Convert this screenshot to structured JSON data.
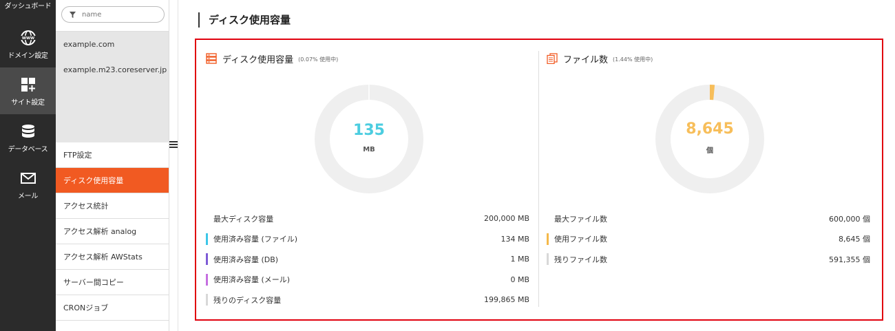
{
  "rail": {
    "top_label": "ダッシュボード",
    "items": [
      {
        "label": "ドメイン設定",
        "icon": "www-globe-icon"
      },
      {
        "label": "サイト設定",
        "icon": "site-grid-icon",
        "active": true
      },
      {
        "label": "データベース",
        "icon": "database-icon"
      },
      {
        "label": "メール",
        "icon": "mail-icon"
      }
    ]
  },
  "panel": {
    "search_placeholder": "name",
    "domains": [
      "example.com",
      "example.m23.coreserver.jp"
    ],
    "menu": [
      {
        "label": "FTP設定"
      },
      {
        "label": "ディスク使用容量",
        "active": true
      },
      {
        "label": "アクセス統計"
      },
      {
        "label": "アクセス解析 analog"
      },
      {
        "label": "アクセス解析 AWStats"
      },
      {
        "label": "サーバー間コピー"
      },
      {
        "label": "CRONジョブ"
      }
    ]
  },
  "page_title": "ディスク使用容量",
  "disk": {
    "title": "ディスク使用容量",
    "sub": "(0.07% 使用中)",
    "value": "135",
    "unit": "MB",
    "used_fraction": 0.0007,
    "color": "#4ccde0",
    "rows": [
      {
        "label": "最大ディスク容量",
        "value": "200,000 MB",
        "mark": ""
      },
      {
        "label": "使用済み容量 (ファイル)",
        "value": "134 MB",
        "mark": "#3cc6e8"
      },
      {
        "label": "使用済み容量 (DB)",
        "value": "1 MB",
        "mark": "#7e5bd6"
      },
      {
        "label": "使用済み容量 (メール)",
        "value": "0 MB",
        "mark": "#c56fe0"
      },
      {
        "label": "残りのディスク容量",
        "value": "199,865 MB",
        "mark": "#d8d8d8"
      }
    ]
  },
  "files": {
    "title": "ファイル数",
    "sub": "(1.44% 使用中)",
    "value": "8,645",
    "unit": "個",
    "used_fraction": 0.0144,
    "color": "#f7be5a",
    "rows": [
      {
        "label": "最大ファイル数",
        "value": "600,000 個",
        "mark": ""
      },
      {
        "label": "使用ファイル数",
        "value": "8,645 個",
        "mark": "#f5b94a"
      },
      {
        "label": "残りファイル数",
        "value": "591,355 個",
        "mark": "#d8d8d8"
      }
    ]
  },
  "colors": {
    "accent": "#f15a22",
    "highlight": "#e0000d",
    "donut_track": "#efefef"
  }
}
